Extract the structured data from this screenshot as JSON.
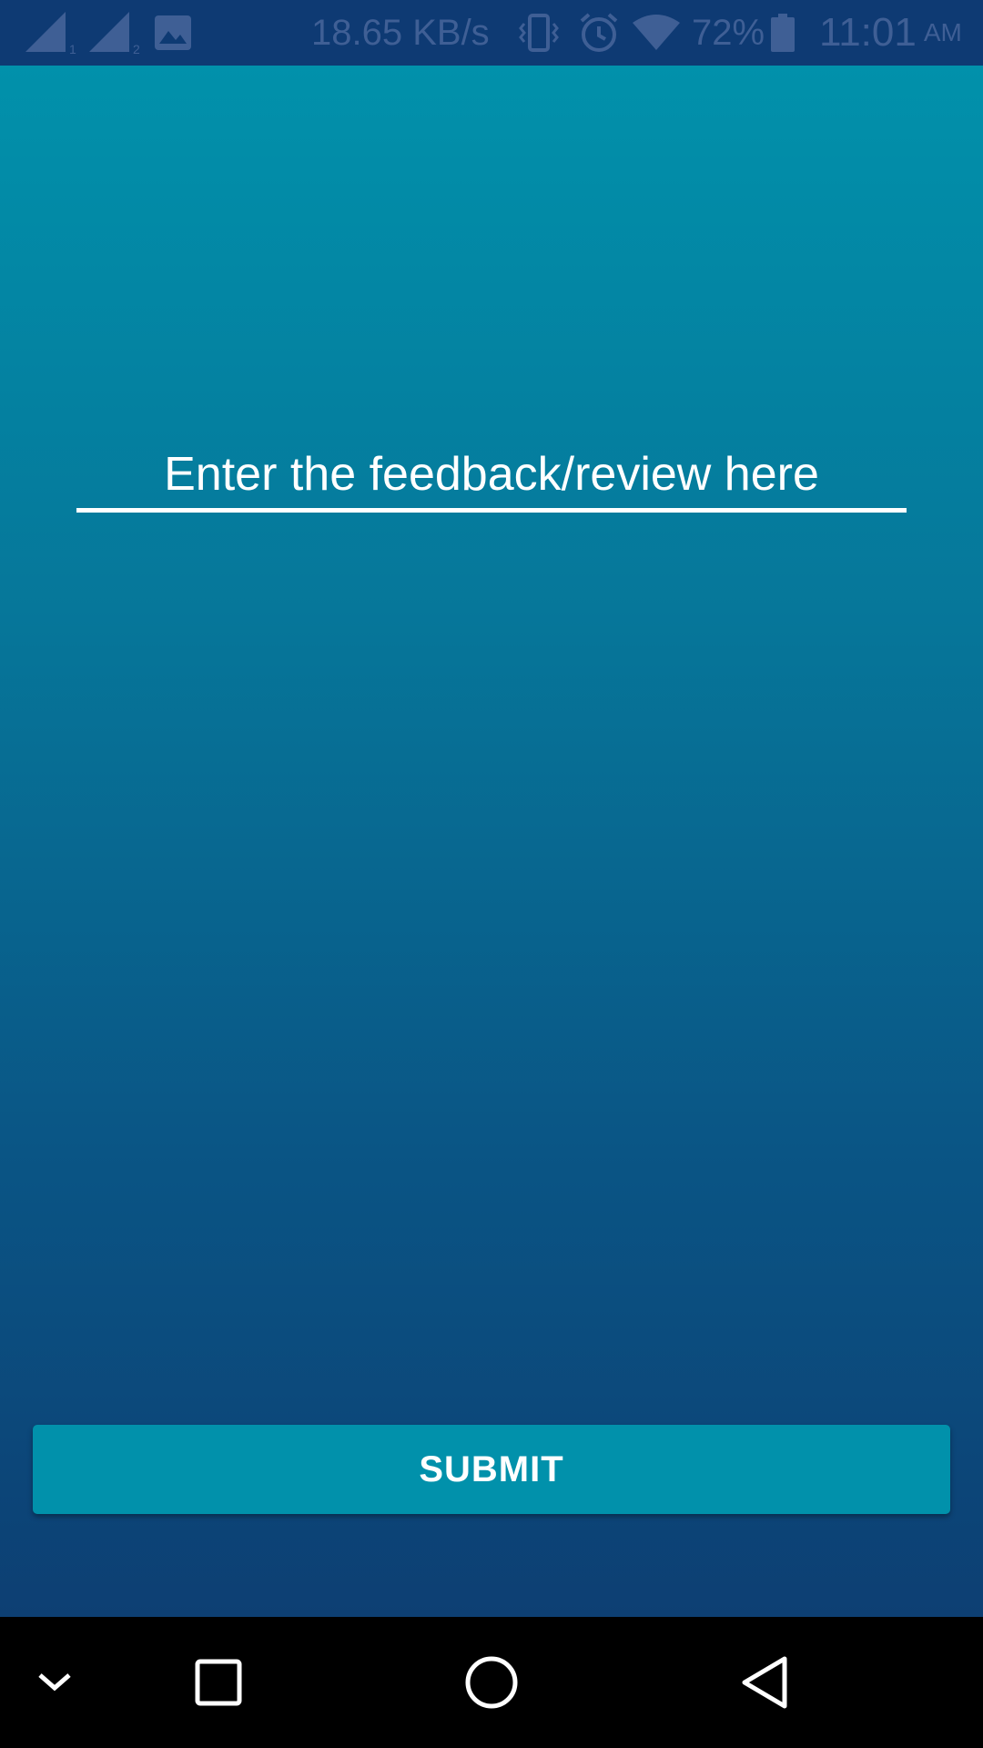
{
  "status_bar": {
    "net_speed": "18.65 KB/s",
    "battery": "72%",
    "time": "11:01",
    "ampm": "AM",
    "sim1_label": "1",
    "sim2_label": "2",
    "icons": [
      "signal-sim1-icon",
      "signal-sim2-icon",
      "image-notification-icon",
      "vibrate-icon",
      "alarm-icon",
      "wifi-icon",
      "battery-icon"
    ]
  },
  "feedback": {
    "placeholder": "Enter the feedback/review here",
    "value": ""
  },
  "submit": {
    "label": "SUBMIT"
  },
  "nav_bar": {
    "icons": [
      "hide-nav-icon",
      "recent-apps-icon",
      "home-icon",
      "back-icon"
    ]
  },
  "colors": {
    "status_bar_bg": "#0e3a73",
    "gradient_top": "#0191ab",
    "gradient_bottom": "#0d3f73",
    "button_bg": "#0191ab",
    "text": "#ffffff"
  }
}
